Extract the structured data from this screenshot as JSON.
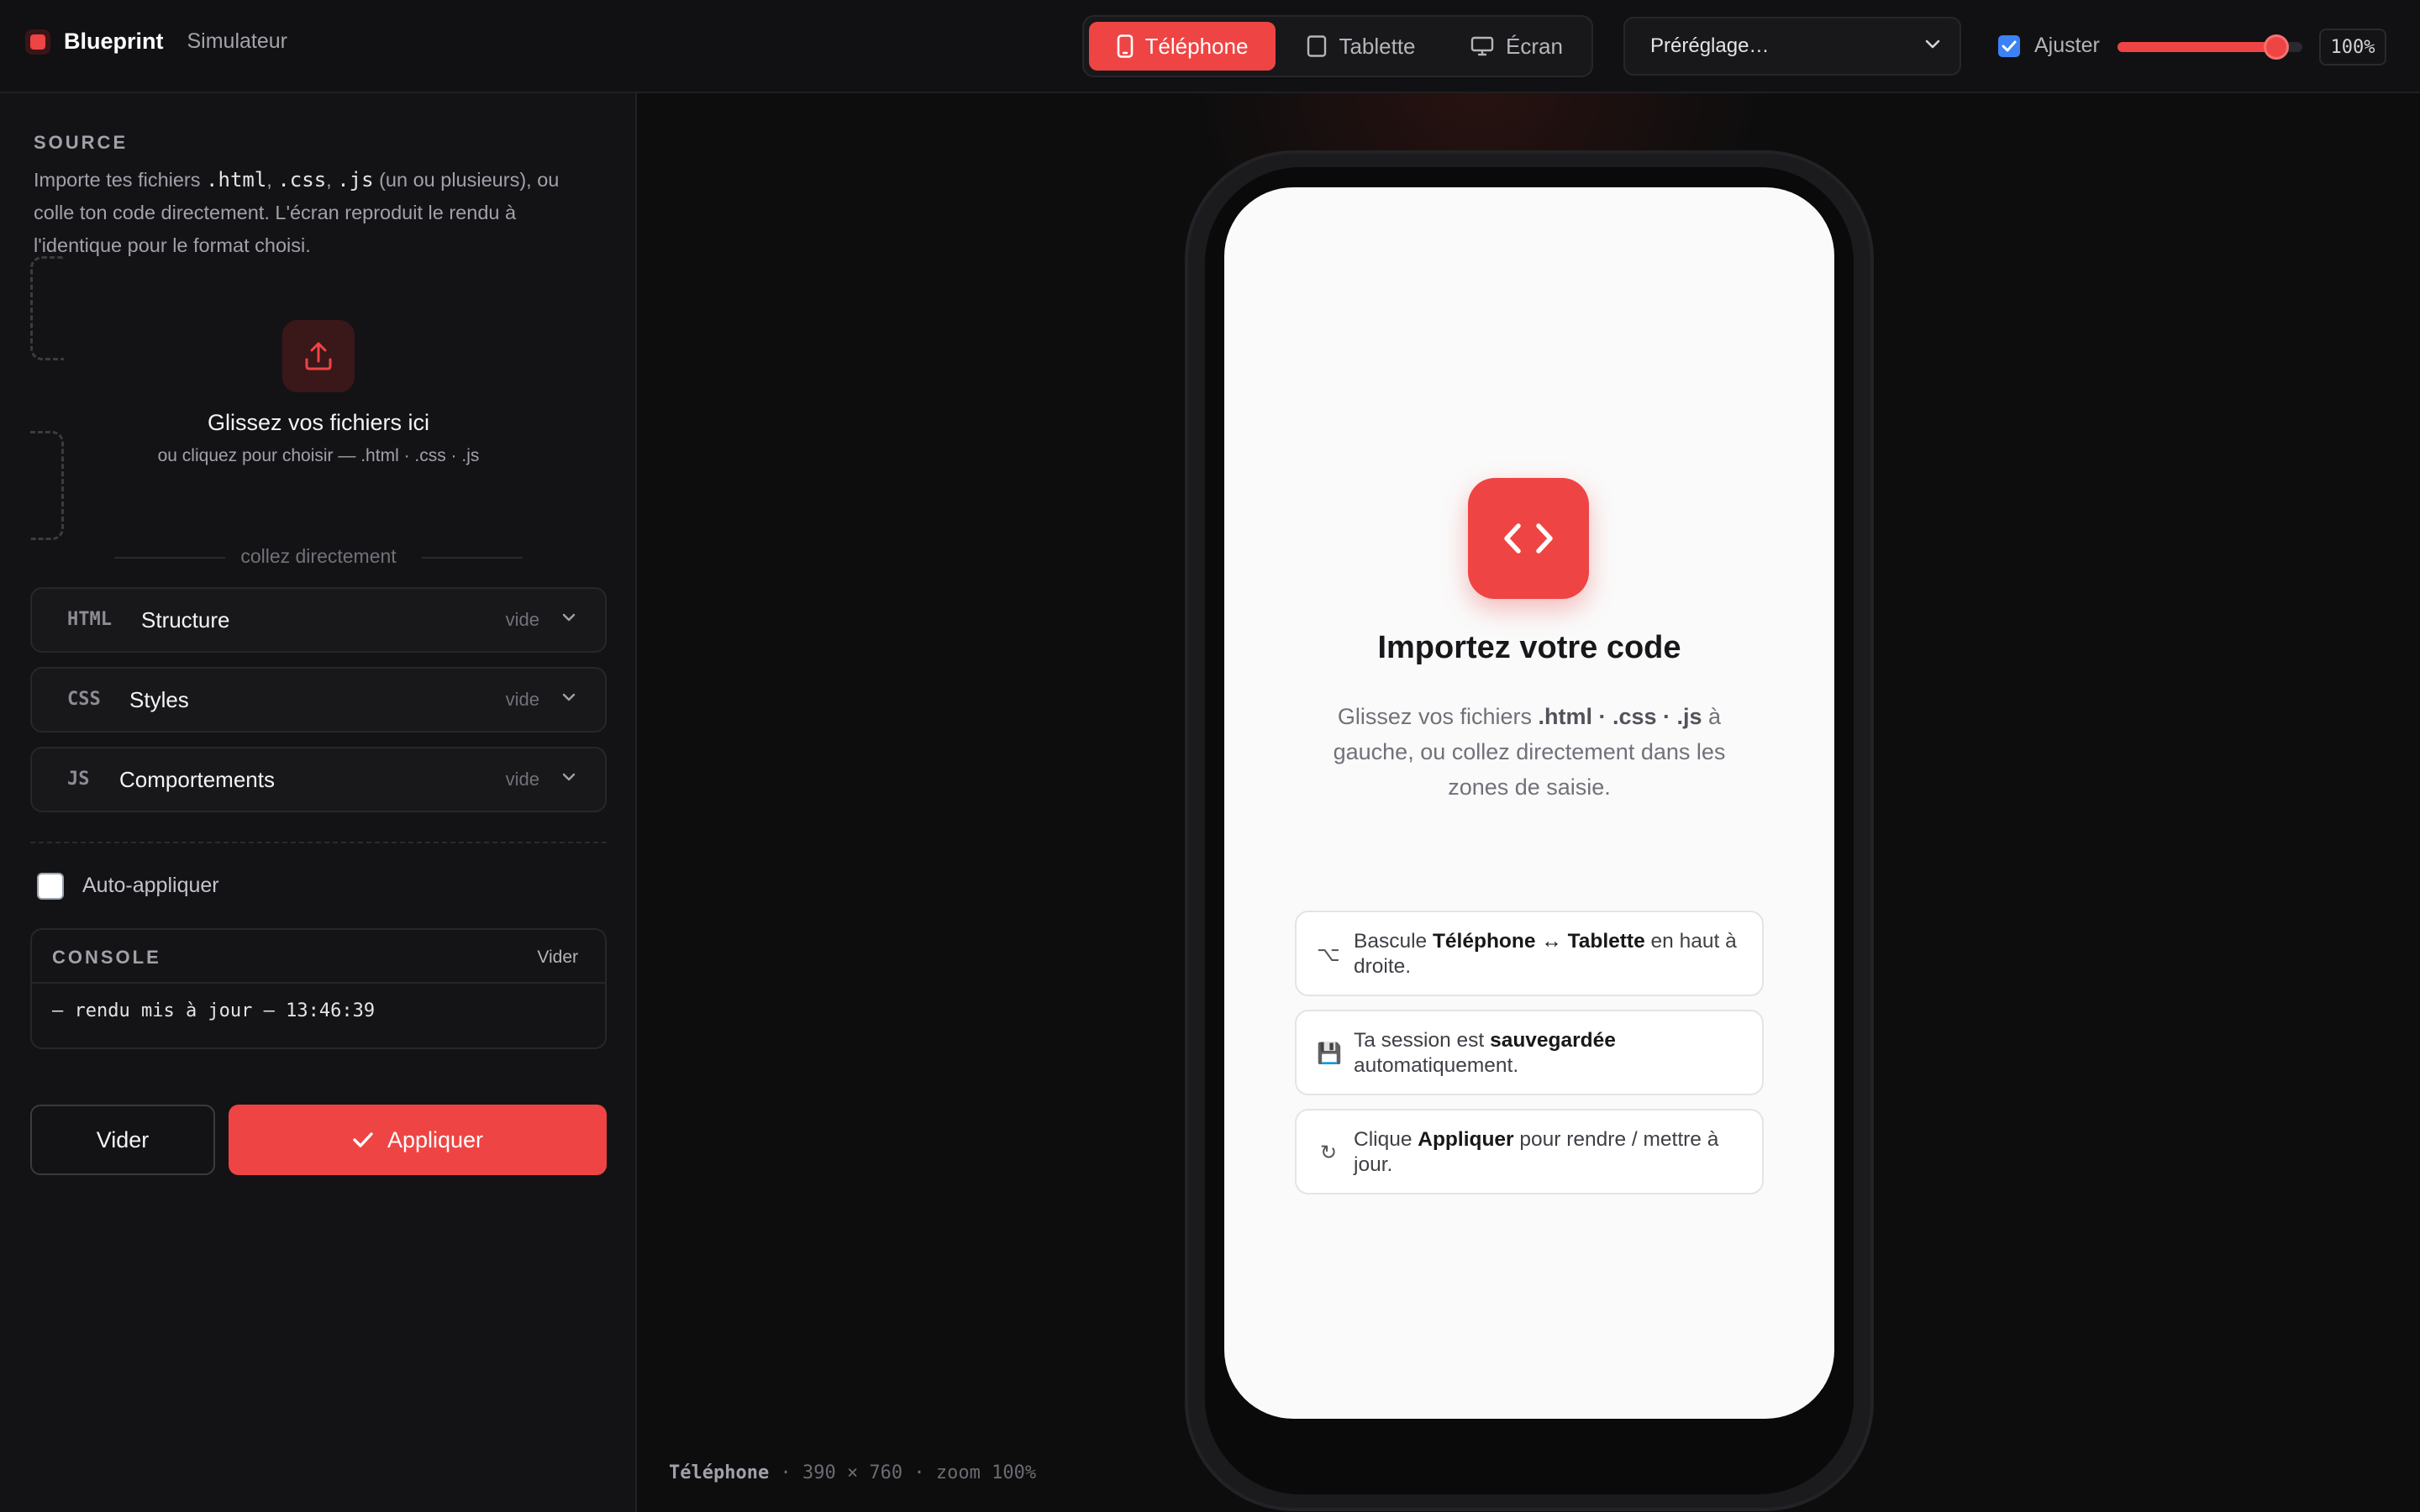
{
  "header": {
    "brand": "Blueprint",
    "subtitle": "Simulateur",
    "devices": [
      {
        "label": "Téléphone",
        "active": true,
        "icon": "phone-icon"
      },
      {
        "label": "Tablette",
        "active": false,
        "icon": "tablet-icon"
      },
      {
        "label": "Écran",
        "active": false,
        "icon": "monitor-icon"
      }
    ],
    "preset_value": "Préréglage…",
    "fit_label": "Ajuster",
    "fit_checked": true,
    "zoom_percent": 100,
    "zoom_text": "100%",
    "accent_color": "#ef4444"
  },
  "panel": {
    "source_title": "SOURCE",
    "source_desc": {
      "part1": "Importe tes fichiers ",
      "code1": ".html",
      "sep1": ", ",
      "code2": ".css",
      "sep2": ", ",
      "code3": ".js",
      "part2": " (un ou plusieurs), ou colle ton code directement. L'écran reproduit le rendu à l'identique pour le format choisi."
    },
    "drop": {
      "title": "Glissez vos fichiers ici",
      "subtitle": "ou cliquez pour choisir — .html · .css · .js",
      "icon": "upload-icon"
    },
    "paste_label": "collez directement",
    "editors": [
      {
        "tag": "HTML",
        "name": "Structure",
        "state": "vide"
      },
      {
        "tag": "CSS",
        "name": "Styles",
        "state": "vide"
      },
      {
        "tag": "JS",
        "name": "Comportements",
        "state": "vide"
      }
    ],
    "auto_apply_label": "Auto-appliquer",
    "auto_apply_checked": false,
    "console": {
      "title": "CONSOLE",
      "clear_label": "Vider",
      "line": "— rendu mis à jour — 13:46:39"
    },
    "clear_button": "Vider",
    "apply_button": "Appliquer"
  },
  "preview": {
    "title": "Importez votre code",
    "desc": {
      "part1": "Glissez vos fichiers ",
      "bold": ".html · .css · .js",
      "part2": " à gauche, ou collez directement dans les zones de saisie."
    },
    "tips": [
      {
        "icon": "⌥",
        "pre": "Bascule ",
        "bold": "Téléphone ↔ Tablette",
        "post": " en haut à droite."
      },
      {
        "icon": "💾",
        "pre": "Ta session est ",
        "bold": "sauvegardée",
        "post": " automatiquement."
      },
      {
        "icon": "↻",
        "pre": "Clique ",
        "bold": "Appliquer",
        "post": " pour rendre / mettre à jour."
      }
    ]
  },
  "status": {
    "device": "Téléphone",
    "dims": "· 390 × 760 · zoom 100%"
  }
}
